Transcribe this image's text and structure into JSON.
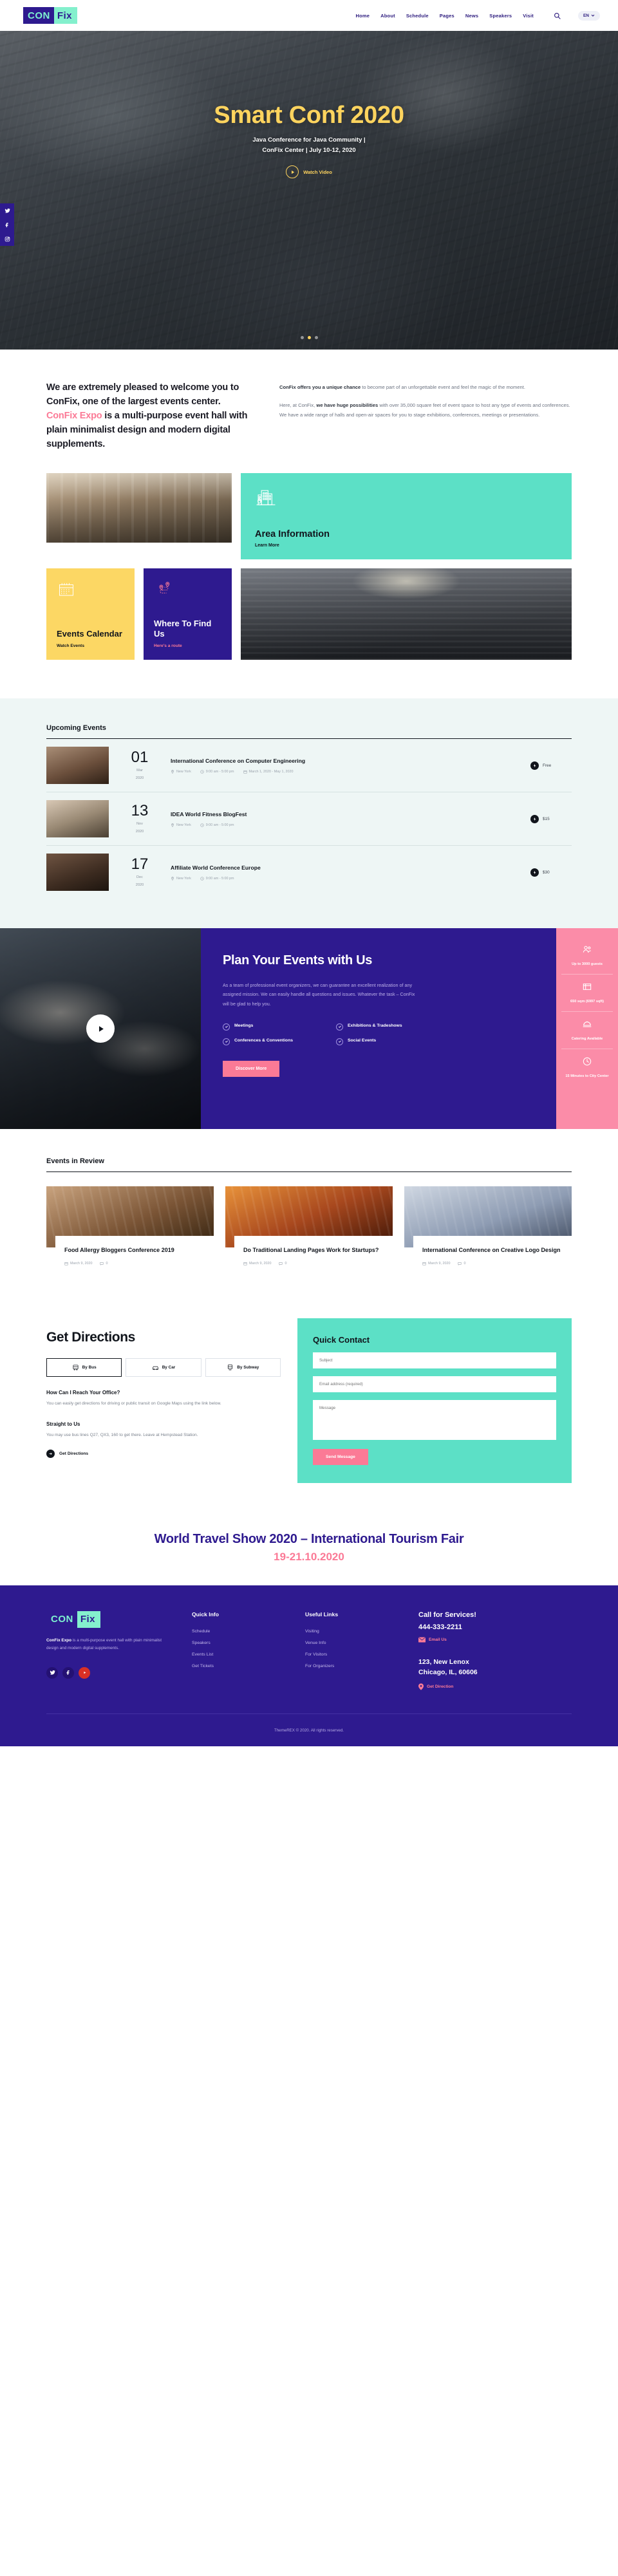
{
  "header": {
    "logo": {
      "part1": "CON",
      "part2": "Fix"
    },
    "nav": [
      {
        "label": "Home",
        "active": true
      },
      {
        "label": "About",
        "active": false
      },
      {
        "label": "Schedule",
        "active": false
      },
      {
        "label": "Pages",
        "active": false
      },
      {
        "label": "News",
        "active": false
      },
      {
        "label": "Speakers",
        "active": false
      },
      {
        "label": "Visit",
        "active": false
      }
    ],
    "search_icon": "search-icon",
    "language": "EN"
  },
  "hero": {
    "title": "Smart Conf 2020",
    "subtitle_line1": "Java Conference for Java Community |",
    "subtitle_line2": "ConFix Center | July 10-12, 2020",
    "watch_label": "Watch Video",
    "slide_count": 3,
    "active_slide": 2
  },
  "social_rail": [
    {
      "name": "twitter-icon",
      "glyph": "✉"
    },
    {
      "name": "facebook-icon",
      "glyph": "f"
    },
    {
      "name": "instagram-icon",
      "glyph": "▣"
    }
  ],
  "welcome": {
    "heading_a": "We are extremely pleased to welcome you to ConFix, one of the largest events center. ",
    "heading_accent": "ConFix Expo",
    "heading_b": " is a multi-purpose event hall with plain minimalist design and modern digital supplements.",
    "p1_bold": "ConFix offers you a unique chance",
    "p1_rest": " to become part of an unforgettable event and feel the magic of the moment.",
    "p2_pre": "Here, at ConFix, ",
    "p2_bold": "we have huge possibilities",
    "p2_rest": " with over 35,000 square feet of event space to host any type of events and conferences. We have a wide range of halls and open-air spaces for you to stage exhibitions, conferences, meetings or presentations."
  },
  "cards": {
    "area": {
      "title": "Area Information",
      "link": "Learn More",
      "icon": "building-icon",
      "color": "#5ce0c6"
    },
    "calendar": {
      "title": "Events Calendar",
      "link": "Watch Events",
      "icon": "calendar-icon",
      "color": "#fcd764"
    },
    "find": {
      "title": "Where To Find Us",
      "link": "Here's a route",
      "icon": "map-route-icon",
      "color": "#2e1a8f"
    }
  },
  "upcoming": {
    "heading": "Upcoming Events",
    "events": [
      {
        "day": "01",
        "month": "Mar",
        "year": "2020",
        "title": "International Conference on Computer Engineering",
        "location": "New York",
        "time": "9:00 am - 5:00 pm",
        "date_meta": "March 1, 2020 - May 1, 2020",
        "price": "Free"
      },
      {
        "day": "13",
        "month": "Nov",
        "year": "2020",
        "title": "IDEA World Fitness BlogFest",
        "location": "New York",
        "time": "9:00 am - 5:00 pm",
        "date_meta": "",
        "price": "$15"
      },
      {
        "day": "17",
        "month": "Dec",
        "year": "2020",
        "title": "Affiliate World Conference Europe",
        "location": "New York",
        "time": "9:00 am - 5:00 pm",
        "date_meta": "",
        "price": "$30"
      }
    ]
  },
  "plan": {
    "title": "Plan Your Events with Us",
    "paragraph": "As a team of professional event organizers, we can guarantee an excellent realization of any assigned mission. We can easily handle all questions and  issues. Whatever the task – ConFix will be glad to help you.",
    "features": [
      "Meetings",
      "Exhibitions & Tradeshows",
      "Conferences & Conventions",
      "Social Events"
    ],
    "button": "Discover More",
    "play_icon": "play-icon",
    "stats": [
      {
        "icon": "users-icon",
        "value": "Up to 3000 guests"
      },
      {
        "icon": "area-icon",
        "value": "650 sqm (6997 sqft)"
      },
      {
        "icon": "catering-icon",
        "value": "Catering Available"
      },
      {
        "icon": "clock-icon",
        "value": "15 Minutes to City Center"
      }
    ]
  },
  "review": {
    "heading": "Events in Review",
    "posts": [
      {
        "title": "Food Allergy Bloggers Conference 2019",
        "date": "March 9, 2020",
        "comments": "0"
      },
      {
        "title": "Do Traditional Landing Pages Work for Startups?",
        "date": "March 9, 2020",
        "comments": "0"
      },
      {
        "title": "International Conference on Creative Logo Design",
        "date": "March 9, 2020",
        "comments": "0"
      }
    ]
  },
  "directions": {
    "heading": "Get Directions",
    "tabs": [
      {
        "label": "By Bus",
        "icon": "bus-icon",
        "active": true
      },
      {
        "label": "By Car",
        "icon": "car-icon",
        "active": false
      },
      {
        "label": "By Subway",
        "icon": "subway-icon",
        "active": false
      }
    ],
    "block1_title": "How Can I Reach Your Office?",
    "block1_text": "You can easily get directions for driving or public transit on Google Maps using the link below.",
    "block2_title": "Straight to Us",
    "block2_text": "You may use bus lines Q27, QX3, 160 to get there. Leave at Hempstead Station.",
    "cta": "Get Directions"
  },
  "contact": {
    "heading": "Quick Contact",
    "subject_placeholder": "Subject",
    "email_placeholder": "Email address (required)",
    "message_placeholder": "Message",
    "button": "Send Message"
  },
  "travel": {
    "line1": "World Travel Show 2020 – International Tourism Fair",
    "line2": "19-21.10.2020"
  },
  "footer": {
    "logo": {
      "part1": "CON",
      "part2": "Fix"
    },
    "about_bold": "ConFix Expo",
    "about_rest": " is a multi-purpose event hall with plain minimalist design and modern digital supplements.",
    "social": [
      {
        "name": "twitter-icon",
        "glyph": "✉"
      },
      {
        "name": "facebook-icon",
        "glyph": "f"
      },
      {
        "name": "youtube-icon",
        "glyph": "▶"
      }
    ],
    "quick_info": {
      "title": "Quick Info",
      "links": [
        "Schedule",
        "Speakers",
        "Events List",
        "Get Tickets"
      ]
    },
    "useful_links": {
      "title": "Useful Links",
      "links": [
        "Visiting",
        "Venue Info",
        "For Visitors",
        "For Organizers"
      ]
    },
    "contact": {
      "title": "Call for Services!",
      "phone": "444-333-2211",
      "email_label": "Email Us",
      "address_line1": "123, New Lenox",
      "address_line2": "Chicago, IL, 60606",
      "direction_label": "Get Direction"
    },
    "copyright": "ThemeREX © 2020. All rights reserved."
  }
}
